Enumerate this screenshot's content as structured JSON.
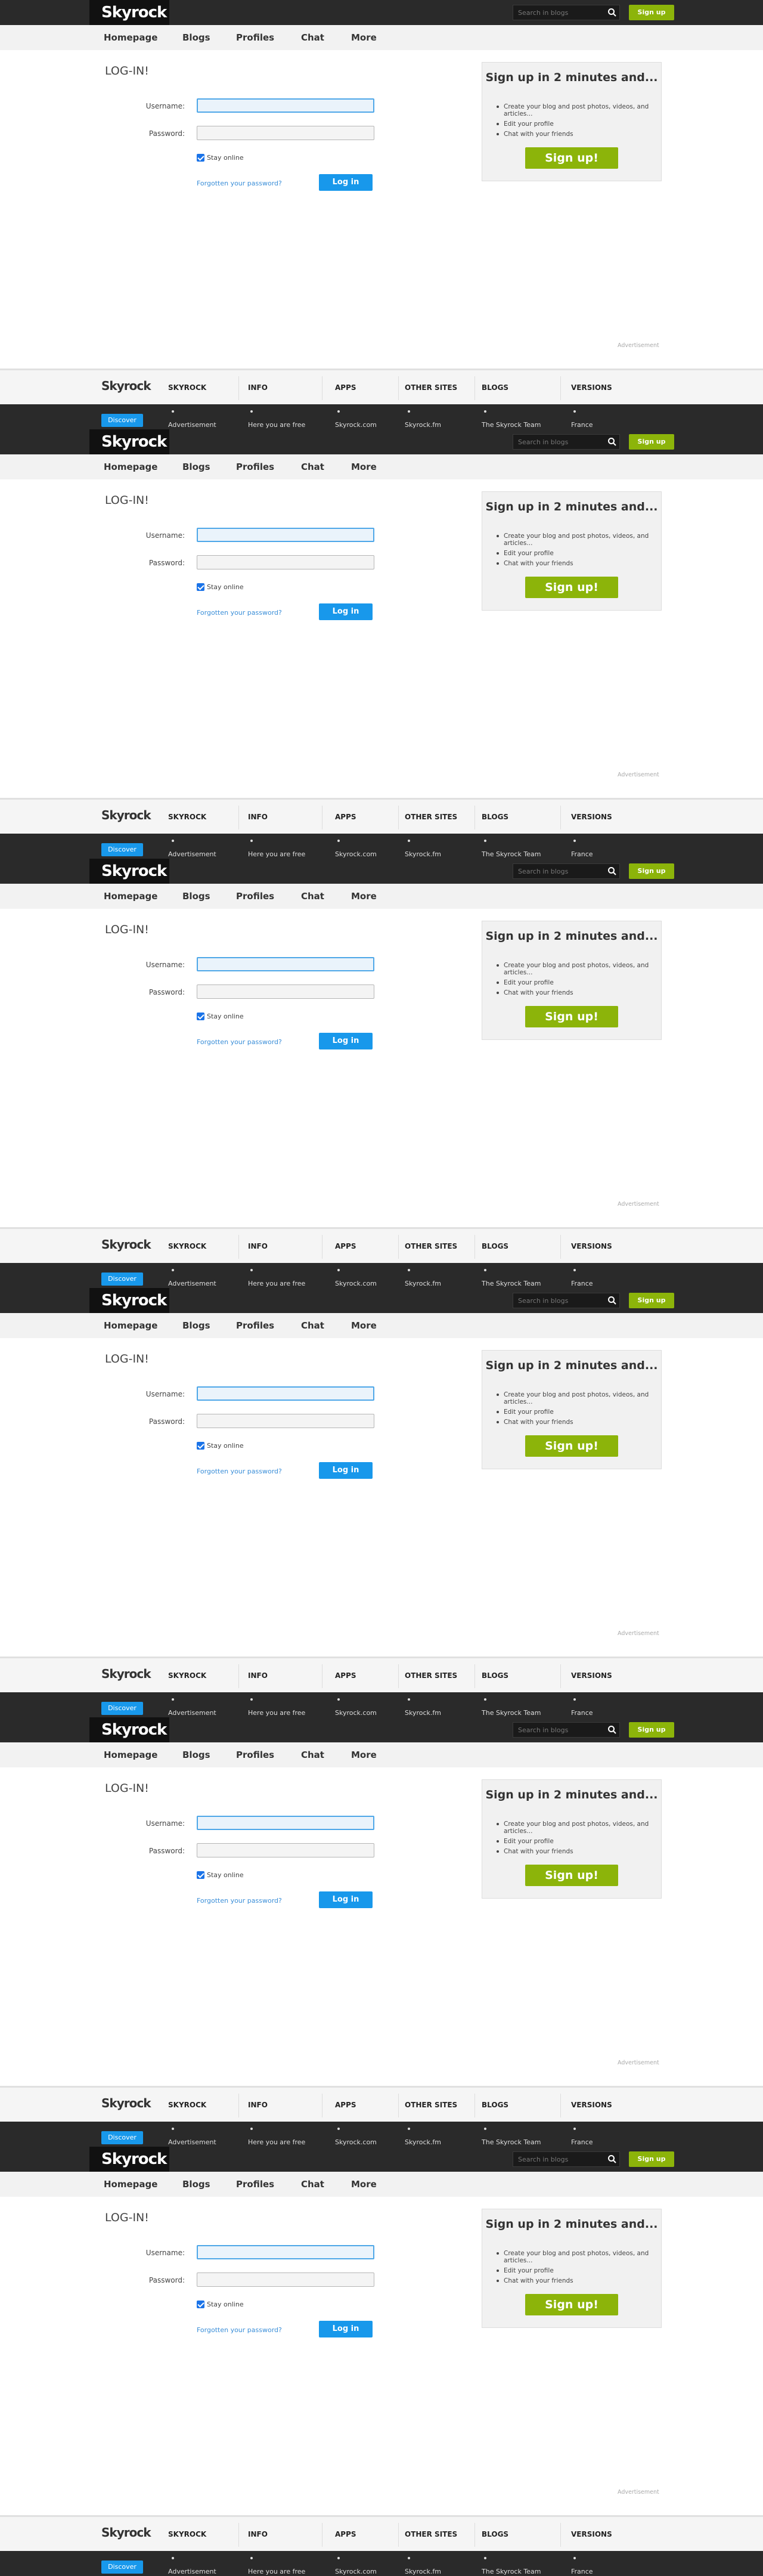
{
  "brand": {
    "logo_text": "Skyrock",
    "accent_blue": "#1898eb",
    "accent_green": "#8cb40a"
  },
  "topbar": {
    "search_placeholder": "Search in blogs",
    "signup_label": "Sign up"
  },
  "nav": {
    "items": [
      "Homepage",
      "Blogs",
      "Profiles",
      "Chat",
      "More"
    ]
  },
  "login": {
    "title": "LOG-IN!",
    "username_label": "Username:",
    "username_value": "",
    "password_label": "Password:",
    "stay_online_label": "Stay online",
    "stay_online_checked": true,
    "forgot_label": "Forgotten your password?",
    "submit_label": "Log in"
  },
  "signup_panel": {
    "title": "Sign up in 2 minutes and...",
    "items": [
      "Create your blog and post photos, videos, and articles...",
      "Edit your profile",
      "Chat with your friends"
    ],
    "button_label": "Sign up!"
  },
  "advertisement_label": "Advertisement",
  "footer": {
    "logo_text": "Skyrock",
    "columns": [
      "SKYROCK",
      "INFO",
      "APPS",
      "OTHER SITES",
      "BLOGS",
      "VERSIONS"
    ],
    "discover_label": "Discover",
    "links": [
      "Advertisement",
      "Here you are free",
      "Skyrock.com",
      "Skyrock.fm",
      "The Skyrock Team",
      "France"
    ]
  }
}
